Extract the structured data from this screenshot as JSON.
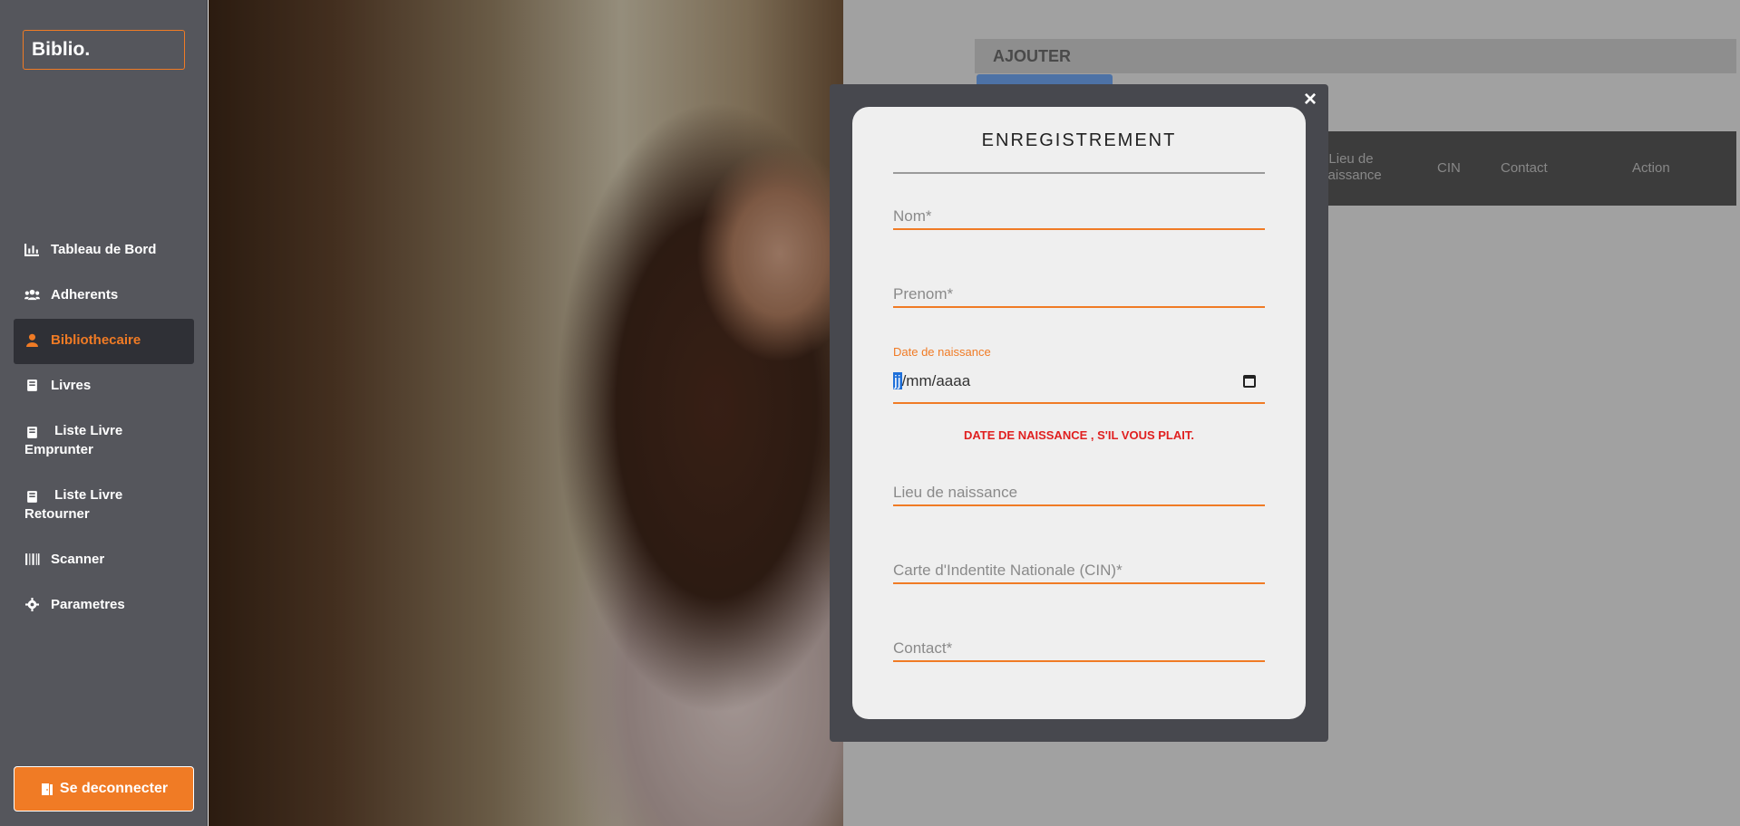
{
  "app": {
    "logo": "Biblio."
  },
  "sidebar": {
    "items": [
      {
        "label": "Tableau de Bord",
        "icon": "chart-icon"
      },
      {
        "label": "Adherents",
        "icon": "users-icon"
      },
      {
        "label": "Bibliothecaire",
        "icon": "user-icon",
        "active": true
      },
      {
        "label": "Livres",
        "icon": "book-icon"
      },
      {
        "label": "Liste Livre Emprunter",
        "icon": "book-icon"
      },
      {
        "label": "Liste Livre Retourner",
        "icon": "book-icon"
      },
      {
        "label": "Scanner",
        "icon": "barcode-icon"
      },
      {
        "label": "Parametres",
        "icon": "gear-icon"
      }
    ],
    "logout": "Se deconnecter"
  },
  "background": {
    "bar_title": "AJOUTER",
    "table_headers": [
      "Lieu de naissance",
      "CIN",
      "Contact",
      "Action"
    ]
  },
  "modal": {
    "title": "ENREGISTREMENT",
    "fields": {
      "nom": "Nom*",
      "prenom": "Prenom*",
      "date_label": "Date de naissance",
      "date_value_cursor": "jj",
      "date_value_rest": "/mm/aaaa",
      "error": "DATE DE NAISSANCE , S'IL VOUS PLAIT.",
      "lieu": "Lieu de naissance",
      "cin": "Carte d'Indentite Nationale (CIN)*",
      "contact": "Contact*"
    },
    "close": "×"
  },
  "colors": {
    "accent": "#f07b25",
    "sidebar": "#55565c",
    "error": "#e02020"
  }
}
